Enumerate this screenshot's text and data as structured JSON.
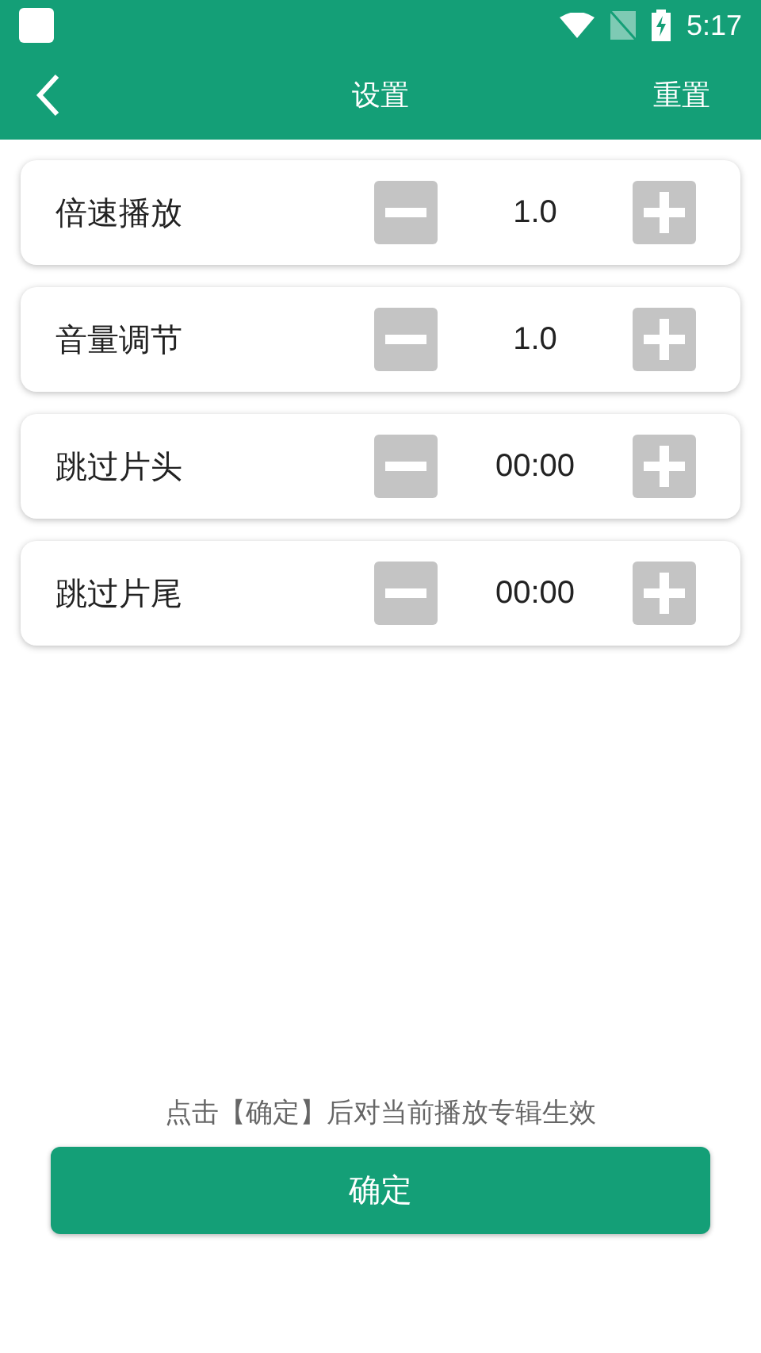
{
  "status_bar": {
    "time": "5:17"
  },
  "app_bar": {
    "title": "设置",
    "action": "重置"
  },
  "settings": [
    {
      "label": "倍速播放",
      "value": "1.0"
    },
    {
      "label": "音量调节",
      "value": "1.0"
    },
    {
      "label": "跳过片头",
      "value": "00:00"
    },
    {
      "label": "跳过片尾",
      "value": "00:00"
    }
  ],
  "hint": "点击【确定】后对当前播放专辑生效",
  "confirm_button": "确定"
}
